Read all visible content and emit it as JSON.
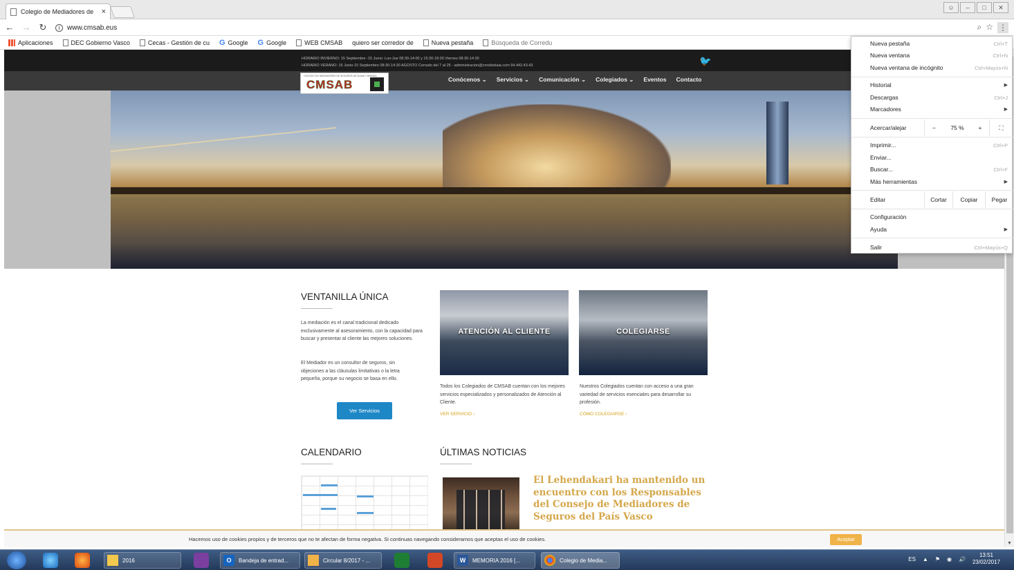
{
  "browser": {
    "tab_title": "Colegio de Mediadores de",
    "tab_close": "×",
    "url": "www.cmsab.eus",
    "bookmarks": [
      {
        "label": "Aplicaciones",
        "icon": "apps-icon"
      },
      {
        "label": "DEC Gobierno Vasco",
        "icon": "page-icon"
      },
      {
        "label": "Cecas - Gestión de cu",
        "icon": "page-icon"
      },
      {
        "label": "Google",
        "icon": "google-icon"
      },
      {
        "label": "Google",
        "icon": "google-icon"
      },
      {
        "label": "WEB CMSAB",
        "icon": "page-icon"
      },
      {
        "label": "quiero ser corredor de",
        "icon": "none"
      },
      {
        "label": "Nueva pestaña",
        "icon": "page-icon"
      },
      {
        "label": "Búsqueda de Corredu",
        "icon": "page-icon"
      }
    ]
  },
  "site": {
    "hours_winter": "HORARIO INVIERNO: 15 Septiembre -15 Junio: Lun-Jue 08:30-14:00 y 15:30-18:30 Viernes 08:30-14:30",
    "hours_summer": "HORARIO VERANO: 15 Junio-15 Septiembre 08:30-14:30 AGOSTO Cerrado del 7 al 25 - administracion@cmsbizkaia.com 94.442.43.43",
    "logo_text": "CMSAB",
    "logo_small": "COLEGIO DE MEDIADORES DE SEGUROS DE ÁLAVA Y BIZKAIA",
    "menu": [
      "Conócenos ⌄",
      "Servicios ⌄",
      "Comunicación ⌄",
      "Colegiados ⌄",
      "Eventos",
      "Contacto"
    ],
    "ventanilla": {
      "title": "VENTANILLA ÚNICA",
      "p1": "La mediación es el canal tradicional dedicado exclusivamente al asesoramiento, con la capacidad para buscar y presentar al cliente las mejores soluciones.",
      "p2": "El Mediador es un consultor de seguros, sin objeciones a las cláusulas limitativas o la letra pequeña, porque su negocio se basa en ello.",
      "button": "Ver Servicios"
    },
    "card_atencion": {
      "overlay": "ATENCIÓN AL CLIENTE",
      "text": "Todos los Colegiados de CMSAB cuentan con los mejores servicios especializados y personalizados de Atención al Cliente.",
      "link": "VER SERVICIO ›"
    },
    "card_colegiarse": {
      "overlay": "COLEGIARSE",
      "text": "Nuestros Colegiados cuentan con acceso a una gran variedad de servicios esenciales para desarrollar su profesión.",
      "link": "CÓMO COLEGIARSE ›"
    },
    "calendario_title": "CALENDARIO",
    "noticias_title": "ÚLTIMAS NOTICIAS",
    "news_headline": "El Lehendakari ha mantenido un encuentro con los Responsables del Consejo de Mediadores de Seguros del País Vasco",
    "cookie_msg": "Hacemos uso de cookies propios y de terceros que no te afectan de forma negativa. Si continuas navegando consideramos que aceptas el uso de cookies.",
    "cookie_accept": "Aceptar"
  },
  "chrome_menu": {
    "new_tab": "Nueva pestaña",
    "new_tab_sc": "Ctrl+T",
    "new_window": "Nueva ventana",
    "new_window_sc": "Ctrl+N",
    "incognito": "Nueva ventana de incógnito",
    "incognito_sc": "Ctrl+Mayús+N",
    "history": "Historial",
    "downloads": "Descargas",
    "downloads_sc": "Ctrl+J",
    "bookmarks": "Marcadores",
    "zoom": "Acercar/alejar",
    "zoom_minus": "−",
    "zoom_value": "75 %",
    "zoom_plus": "+",
    "print": "Imprimir...",
    "print_sc": "Ctrl+P",
    "cast": "Enviar...",
    "find": "Buscar...",
    "find_sc": "Ctrl+F",
    "more_tools": "Más herramientas",
    "edit": "Editar",
    "cut": "Cortar",
    "copy": "Copiar",
    "paste": "Pegar",
    "settings": "Configuración",
    "help": "Ayuda",
    "exit": "Salir",
    "exit_sc": "Ctrl+Mayús+Q"
  },
  "taskbar": {
    "items": [
      "2016",
      "Bandeja de entrad...",
      "Circular 8/2017 - ...",
      "MEMORIA 2016 [...",
      "Colegio de Media..."
    ],
    "lang": "ES",
    "time": "13:51",
    "date": "23/02/2017"
  },
  "colors": {
    "hero_grey": "#bfbfbf",
    "button_blue": "#1e88c7",
    "gold": "#d4a74a",
    "accept": "#f0b34a"
  }
}
